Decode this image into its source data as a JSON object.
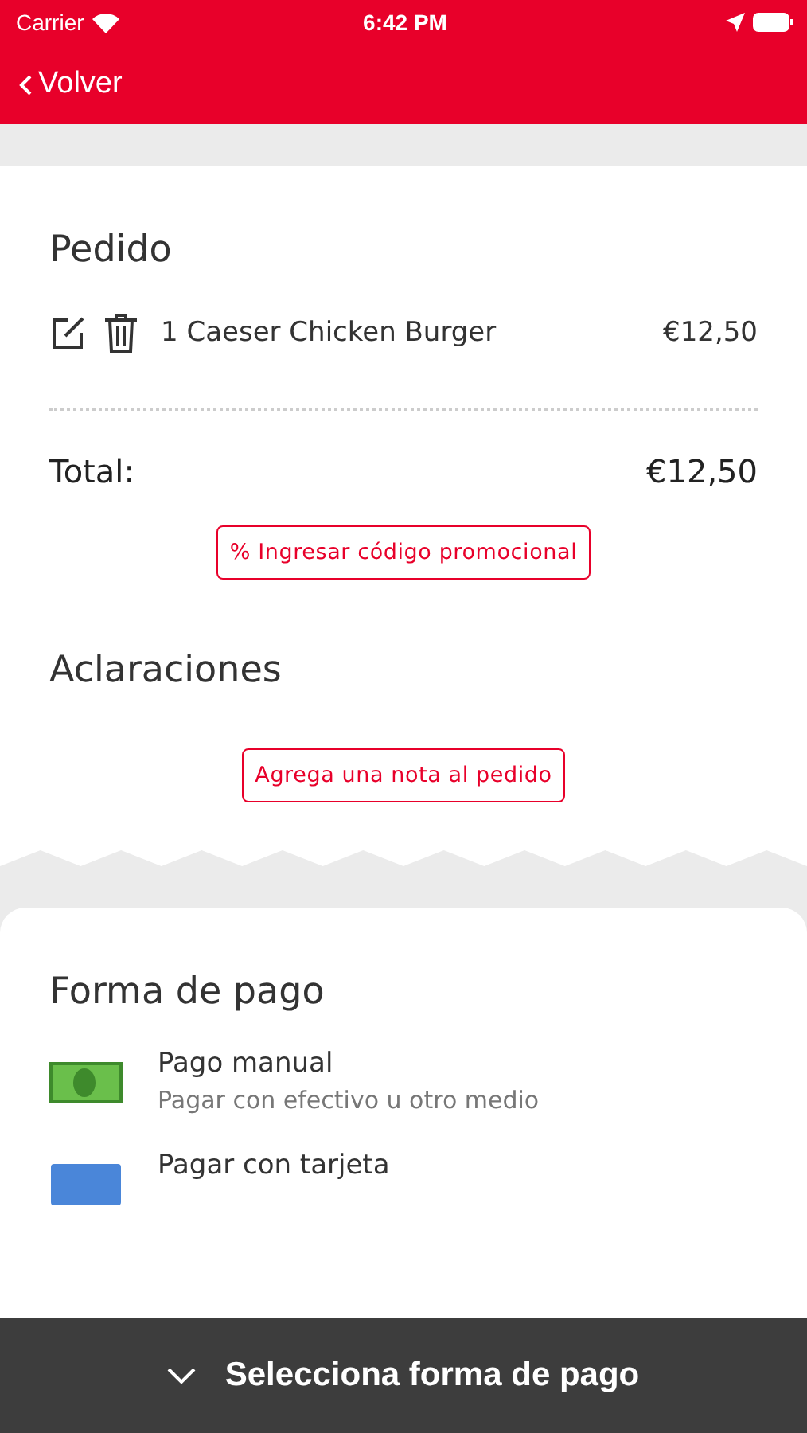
{
  "status_bar": {
    "carrier": "Carrier",
    "time": "6:42 PM"
  },
  "nav": {
    "back": "Volver"
  },
  "order": {
    "title": "Pedido",
    "items": [
      {
        "name": "1 Caeser Chicken Burger",
        "price": "€12,50"
      }
    ],
    "total_label": "Total:",
    "total": "€12,50",
    "promo_button": "% Ingresar código promocional"
  },
  "notes": {
    "title": "Aclaraciones",
    "button": "Agrega una nota al pedido"
  },
  "payment": {
    "title": "Forma de pago",
    "methods": [
      {
        "kind": "cash",
        "title": "Pago manual",
        "subtitle": "Pagar con efectivo u otro medio"
      },
      {
        "kind": "card",
        "title": "Pagar con tarjeta"
      }
    ]
  },
  "bottom_bar": {
    "label": "Selecciona forma de pago"
  }
}
